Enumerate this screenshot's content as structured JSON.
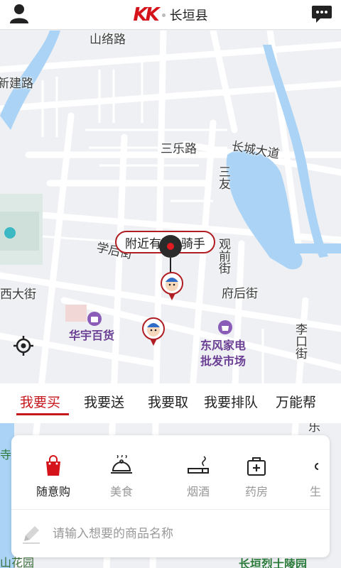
{
  "header": {
    "logo_text": "KK",
    "city": "长垣县",
    "user_icon": "user-icon",
    "chat_icon": "chat-icon"
  },
  "map": {
    "streets": [
      "山络路",
      "新建路",
      "三乐路",
      "长城大道",
      "三友",
      "学后街",
      "观前街",
      "西大街",
      "府后街",
      "李口街",
      "乐"
    ],
    "pois": [
      "华宇百货",
      "东风家电",
      "批发市场",
      "山花园",
      "长垣烈士陵园",
      "寺"
    ],
    "riders_nearby": "附近有8位骑手",
    "locate_icon": "crosshair-icon"
  },
  "tabs": [
    "我要买",
    "我要送",
    "我要取",
    "我要排队",
    "万能帮"
  ],
  "active_tab": "我要买",
  "categories": [
    {
      "label": "随意购",
      "icon": "shopping-bag-icon"
    },
    {
      "label": "美食",
      "icon": "food-cloche-icon"
    },
    {
      "label": "烟酒",
      "icon": "cigarette-icon"
    },
    {
      "label": "药房",
      "icon": "medicine-box-icon"
    },
    {
      "label": "生",
      "icon": "more-icon"
    }
  ],
  "search": {
    "placeholder": "请输入想要的商品名称",
    "value": ""
  },
  "colors": {
    "accent": "#c6171c",
    "map_bg": "#eef0f3",
    "water": "#aad3f5",
    "poi_purple": "#6b3f94"
  }
}
